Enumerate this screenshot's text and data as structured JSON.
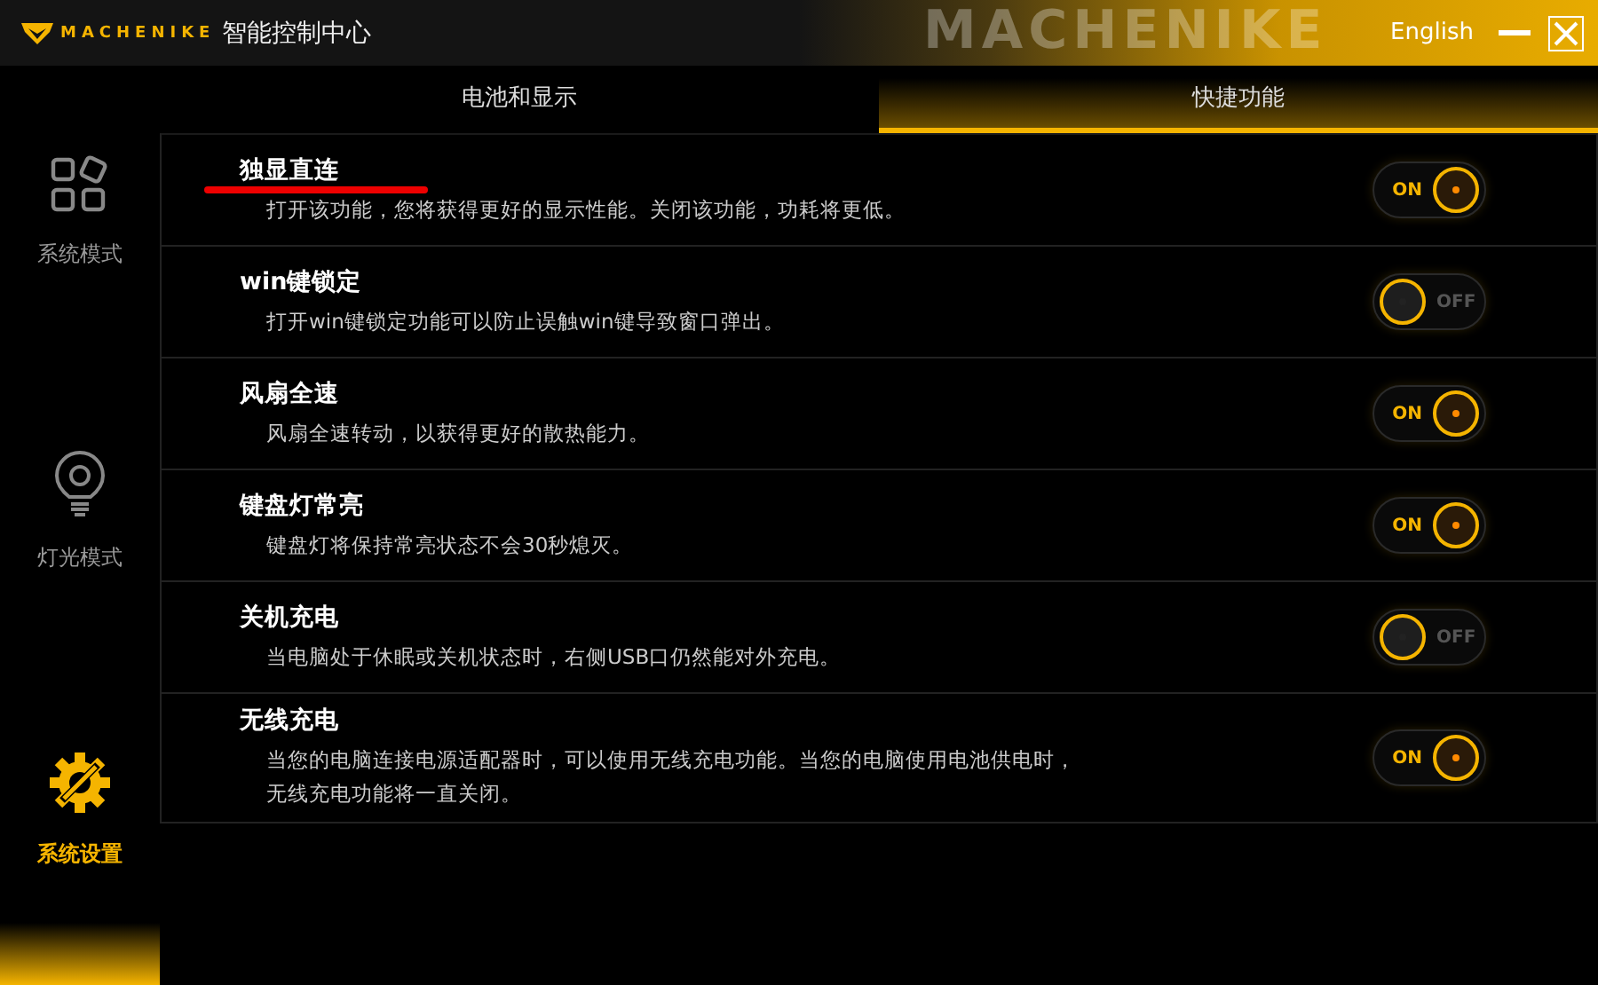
{
  "header": {
    "logo_text": "MACHENIKE",
    "title": "智能控制中心",
    "backdrop_text": "MACHENIKE",
    "language": "English"
  },
  "sidebar": {
    "items": [
      {
        "label": "系统模式",
        "kind": "modes",
        "selected": false
      },
      {
        "label": "灯光模式",
        "kind": "light",
        "selected": false
      },
      {
        "label": "系统设置",
        "kind": "settings",
        "selected": true
      }
    ]
  },
  "tabs": [
    {
      "label": "电池和显示",
      "selected": false
    },
    {
      "label": "快捷功能",
      "selected": true
    }
  ],
  "features": [
    {
      "title": "独显直连",
      "description": "打开该功能，您将获得更好的显示性能。关闭该功能，功耗将更低。",
      "on": true,
      "toggle_label": "ON",
      "underlined": true
    },
    {
      "title": "win键锁定",
      "description": "打开win键锁定功能可以防止误触win键导致窗口弹出。",
      "on": false,
      "toggle_label": "OFF",
      "underlined": false
    },
    {
      "title": "风扇全速",
      "description": "风扇全速转动，以获得更好的散热能力。",
      "on": true,
      "toggle_label": "ON",
      "underlined": false
    },
    {
      "title": "键盘灯常亮",
      "description": "键盘灯将保持常亮状态不会30秒熄灭。",
      "on": true,
      "toggle_label": "ON",
      "underlined": false
    },
    {
      "title": "关机充电",
      "description": "当电脑处于休眠或关机状态时，右侧USB口仍然能对外充电。",
      "on": false,
      "toggle_label": "OFF",
      "underlined": false
    },
    {
      "title": "无线充电",
      "description": "当您的电脑连接电源适配器时，可以使用无线充电功能。当您的电脑使用电池供电时，无线充电功能将一直关闭。",
      "on": true,
      "toggle_label": "ON",
      "underlined": false
    }
  ]
}
